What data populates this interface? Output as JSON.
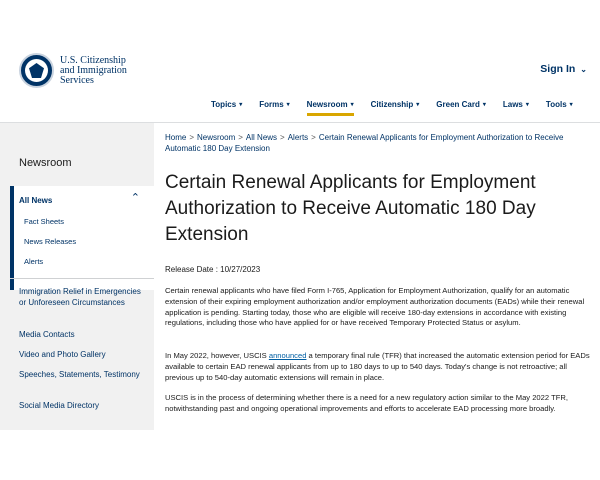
{
  "header": {
    "logo_line1": "U.S. Citizenship",
    "logo_line2": "and Immigration",
    "logo_line3": "Services",
    "signin_label": "Sign In",
    "nav": [
      {
        "label": "Topics"
      },
      {
        "label": "Forms"
      },
      {
        "label": "Newsroom"
      },
      {
        "label": "Citizenship"
      },
      {
        "label": "Green Card"
      },
      {
        "label": "Laws"
      },
      {
        "label": "Tools"
      }
    ]
  },
  "sidebar": {
    "title": "Newsroom",
    "active_group": "All News",
    "sub_items": [
      "Fact Sheets",
      "News Releases",
      "Alerts"
    ],
    "links": [
      "Immigration Relief in Emergencies or Unforeseen Circumstances",
      "Media Contacts",
      "Video and Photo Gallery",
      "Speeches, Statements, Testimony",
      "Social Media Directory"
    ]
  },
  "breadcrumb": {
    "items": [
      "Home",
      "Newsroom",
      "All News",
      "Alerts"
    ],
    "current": "Certain Renewal Applicants for Employment Authorization to Receive Automatic 180 Day Extension"
  },
  "article": {
    "title": "Certain Renewal Applicants for Employment Authorization to Receive Automatic 180 Day Extension",
    "release_label": "Release Date : 10/27/2023",
    "p1": "Certain renewal applicants who have filed Form I-765, Application for Employment Authorization, qualify for an automatic extension of their expiring employment authorization and/or employment authorization documents (EADs) while their renewal application is pending. Starting today, those who are eligible will receive 180-day extensions in accordance with existing regulations, including those who have applied for or have received Temporary Protected Status or asylum.",
    "p2_before": "In May 2022, however, USCIS ",
    "p2_link": "announced",
    "p2_after": " a temporary final rule (TFR) that increased the automatic extension period for EADs available to certain EAD renewal applicants from up to 180 days to up to 540 days. Today's change is not retroactive; all previous up to 540-day automatic extensions will remain in place.",
    "p3": "USCIS is in the process of determining whether there is a need for a new regulatory action similar to the May 2022 TFR, notwithstanding past and ongoing operational improvements and efforts to accelerate EAD processing more broadly."
  },
  "colors": {
    "brand_navy": "#003366",
    "nav_active_underline": "#d9a600",
    "sidebar_bg": "#f1f1f1",
    "link_blue": "#005ea2"
  },
  "icons": {
    "seal": "dhs-seal-icon",
    "chevron": "chevron-down-icon",
    "collapse": "chevron-up-icon"
  }
}
